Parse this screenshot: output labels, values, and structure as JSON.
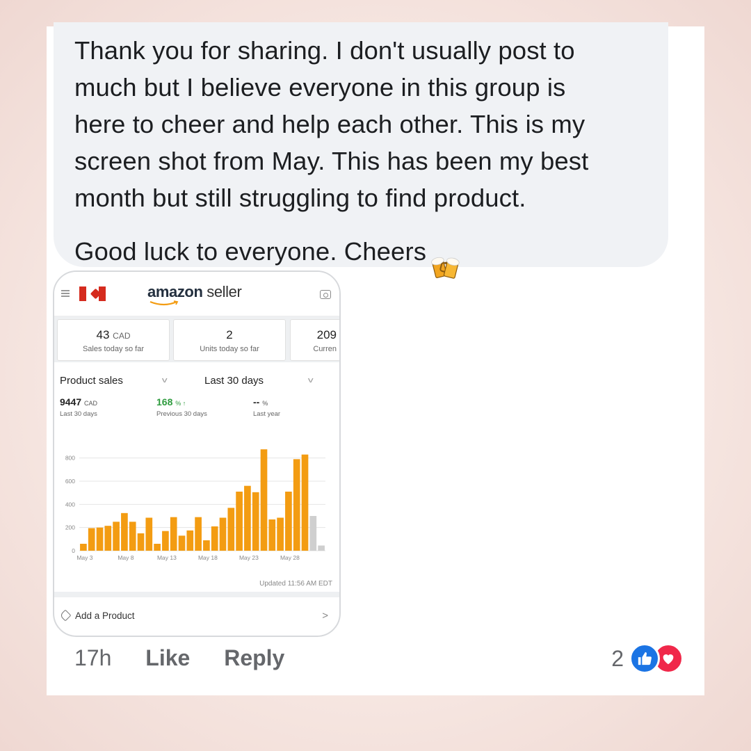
{
  "comment": {
    "text": "Thank you for sharing.  I don't usually post to\nmuch but I believe everyone in this group is\nhere to cheer and help each other.  This is my\nscreen shot from May. This has been my best\nmonth but still struggling to find product.\nGood luck to everyone. Cheers",
    "emoji": "beer-mugs-icon"
  },
  "screenshot": {
    "logo": {
      "brand": "amazon",
      "suffix": "seller"
    },
    "tiles": [
      {
        "value": "43",
        "unit": "CAD",
        "label": "Sales today so far"
      },
      {
        "value": "2",
        "unit": "",
        "label": "Units today so far"
      },
      {
        "value": "209",
        "unit": "",
        "label": "Curren"
      }
    ],
    "selectors": {
      "metric": "Product sales",
      "period": "Last 30 days"
    },
    "metrics": [
      {
        "value": "9447",
        "unit": "CAD",
        "label": "Last 30 days"
      },
      {
        "value": "168",
        "unit": "% ↑",
        "label": "Previous 30 days"
      },
      {
        "value": "--",
        "unit": "%",
        "label": "Last year"
      }
    ],
    "updated": "Updated 11:56 AM EDT",
    "add_product": "Add a Product"
  },
  "chart_data": {
    "type": "bar",
    "x_ticks": [
      "May 3",
      "May 8",
      "May 13",
      "May 18",
      "May 23",
      "May 28"
    ],
    "y_ticks": [
      0,
      200,
      400,
      600,
      800
    ],
    "ylim": [
      0,
      900
    ],
    "bar_color": "#f39c12",
    "today_color": "#cfcfcf",
    "values": [
      60,
      195,
      200,
      215,
      250,
      325,
      250,
      150,
      285,
      60,
      170,
      290,
      130,
      175,
      290,
      90,
      210,
      285,
      370,
      510,
      560,
      505,
      875,
      270,
      285,
      510,
      790,
      830,
      300,
      45
    ],
    "gray_from_index": 28
  },
  "footer": {
    "time": "17h",
    "like": "Like",
    "reply": "Reply",
    "reaction_count": "2"
  },
  "colors": {
    "like": "#1b74e4",
    "love": "#f0284a",
    "bubble": "#f0f2f5"
  }
}
